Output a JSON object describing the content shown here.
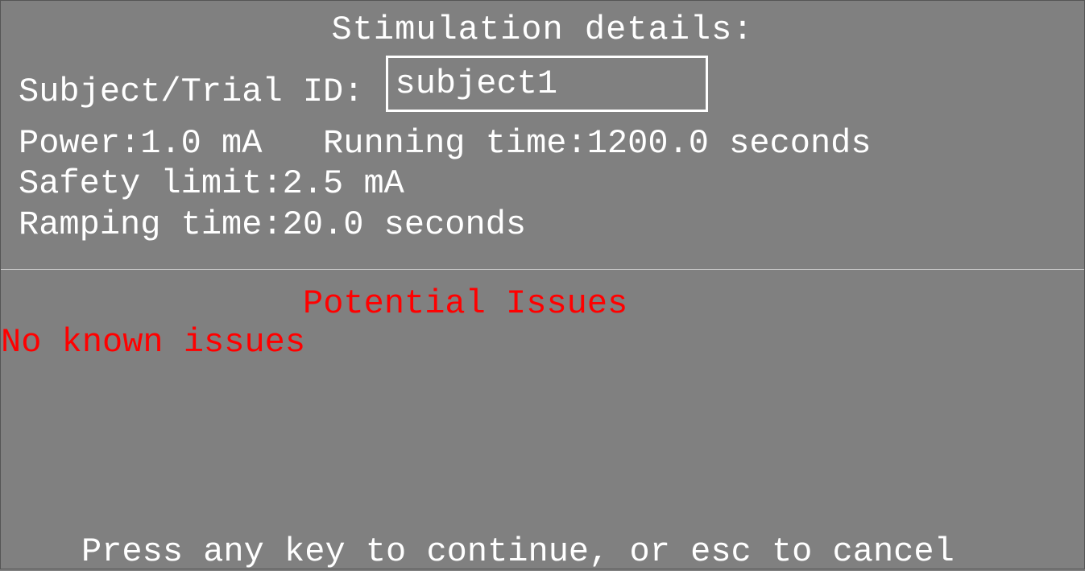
{
  "header": {
    "title": "Stimulation details:"
  },
  "details": {
    "subject_label": "Subject/Trial ID:",
    "subject_value": "subject1",
    "power_running_line": "Power:1.0 mA   Running time:1200.0 seconds",
    "safety_line": "Safety limit:2.5 mA",
    "ramping_line": "Ramping time:20.0 seconds",
    "parameters": {
      "power_mA": 1.0,
      "running_time_seconds": 1200.0,
      "safety_limit_mA": 2.5,
      "ramping_time_seconds": 20.0
    }
  },
  "issues": {
    "header": "Potential Issues",
    "body": "No known issues"
  },
  "footer": {
    "prompt": "Press any key to continue, or esc to cancel"
  },
  "colors": {
    "background": "#808080",
    "text": "#ffffff",
    "alert": "#ff0000"
  }
}
